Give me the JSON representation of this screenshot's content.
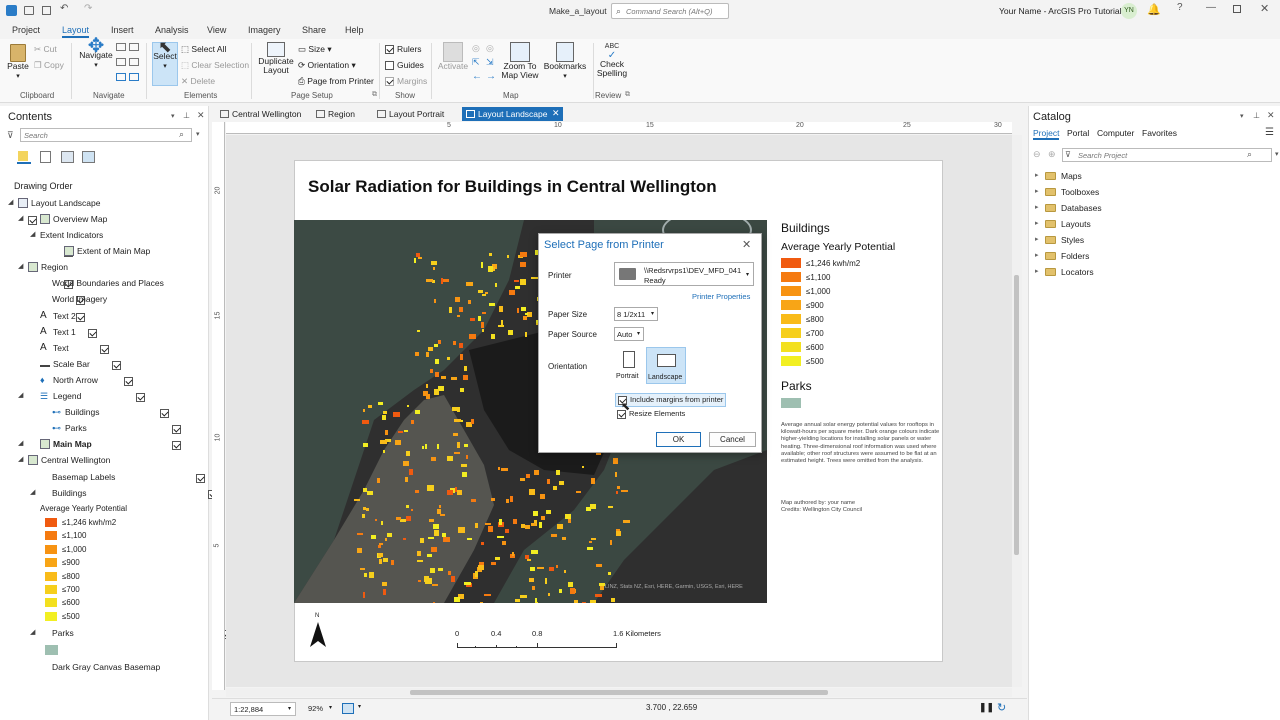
{
  "app": {
    "project_name": "Make_a_layout",
    "search_placeholder": "Command Search (Alt+Q)",
    "user": "Your Name - ArcGIS Pro Tutorials",
    "user_initials": "YN",
    "accent": "#1e6fb8"
  },
  "ribbon_tabs": [
    "Project",
    "Layout",
    "Insert",
    "Analysis",
    "View",
    "Imagery",
    "Share",
    "Help"
  ],
  "ribbon": {
    "clipboard": {
      "paste": "Paste",
      "cut": "Cut",
      "copy": "Copy",
      "label": "Clipboard"
    },
    "navigate": {
      "navigate": "Navigate",
      "label": "Navigate"
    },
    "elements": {
      "select": "Select",
      "select_all": "Select All",
      "clear_selection": "Clear Selection",
      "delete": "Delete",
      "label": "Elements"
    },
    "page_setup": {
      "duplicate": "Duplicate Layout",
      "size": "Size",
      "orientation": "Orientation",
      "page_from_printer": "Page from Printer",
      "label": "Page Setup"
    },
    "show": {
      "rulers": "Rulers",
      "guides": "Guides",
      "margins": "Margins",
      "label": "Show"
    },
    "map": {
      "activate": "Activate",
      "zoom_to": "Zoom To Map View",
      "bookmarks": "Bookmarks",
      "label": "Map"
    },
    "review": {
      "check_spelling": "Check Spelling",
      "abc": "ABC",
      "label": "Review"
    }
  },
  "contents": {
    "title": "Contents",
    "search_placeholder": "Search",
    "drawing_order": "Drawing Order",
    "items": [
      {
        "label": "Layout Landscape"
      },
      {
        "label": "Overview Map"
      },
      {
        "label": "Extent Indicators"
      },
      {
        "label": "Extent of Main Map"
      },
      {
        "label": "Region"
      },
      {
        "label": "World Boundaries and Places"
      },
      {
        "label": "World Imagery"
      },
      {
        "label": "Text 2"
      },
      {
        "label": "Text 1"
      },
      {
        "label": "Text"
      },
      {
        "label": "Scale Bar"
      },
      {
        "label": "North Arrow"
      },
      {
        "label": "Legend"
      },
      {
        "label": "Buildings"
      },
      {
        "label": "Parks"
      },
      {
        "label": "Main Map"
      },
      {
        "label": "Central Wellington"
      },
      {
        "label": "Basemap Labels"
      },
      {
        "label": "Buildings"
      },
      {
        "label": "Average Yearly Potential"
      },
      {
        "label": "Parks"
      },
      {
        "label": "Dark Gray Canvas Basemap"
      }
    ],
    "legend_classes": [
      "≤1,246 kwh/m2",
      "≤1,100",
      "≤1,000",
      "≤900",
      "≤800",
      "≤700",
      "≤600",
      "≤500"
    ],
    "legend_colors": [
      "#f05a10",
      "#f57a10",
      "#f79312",
      "#f8a516",
      "#f9bb19",
      "#f6cf1c",
      "#f3e01f",
      "#f2ef22"
    ],
    "park_color": "#9ebfb1"
  },
  "view_tabs": [
    "Central Wellington",
    "Region",
    "Layout Portrait",
    "Layout Landscape"
  ],
  "ruler_h": [
    "5",
    "10",
    "15",
    "20",
    "25",
    "30"
  ],
  "ruler_v": [
    "20",
    "15",
    "10",
    "5"
  ],
  "layout": {
    "title": "Solar Radiation for Buildings in Central Wellington",
    "legend_title": "Buildings",
    "legend_subtitle": "Average Yearly Potential",
    "parks_title": "Parks",
    "description": "Average annual solar energy potential values for rooftops in kilowatt-hours per square meter. Dark orange colours indicate higher-yielding locations for installing solar panels or water heating. Three-dimensional roof information was used where available; other roof structures were assumed to be flat at an estimated height. Trees were omitted from the analysis.",
    "author": "Map authored by: your name",
    "credits": "Credits: Wellington City Council",
    "attribution": "LINZ, Stats NZ, Esri, HERE, Garmin, USGS, Esri, HERE",
    "north": "N",
    "scale_labels": [
      "0",
      "0.4",
      "0.8",
      "1.6 Kilometers"
    ]
  },
  "dialog": {
    "title": "Select Page from Printer",
    "printer_label": "Printer",
    "printer_name": "\\\\Redsrvrps1\\DEV_MFD_041",
    "printer_status": "Ready",
    "printer_properties": "Printer Properties",
    "paper_size_label": "Paper Size",
    "paper_size": "8 1/2x11",
    "paper_source_label": "Paper Source",
    "paper_source": "Auto",
    "orientation_label": "Orientation",
    "portrait": "Portrait",
    "landscape": "Landscape",
    "include_margins": "Include margins from printer",
    "resize_elements": "Resize Elements",
    "ok": "OK",
    "cancel": "Cancel"
  },
  "catalog": {
    "title": "Catalog",
    "tabs": [
      "Project",
      "Portal",
      "Computer",
      "Favorites"
    ],
    "search_placeholder": "Search Project",
    "items": [
      "Maps",
      "Toolboxes",
      "Databases",
      "Layouts",
      "Styles",
      "Folders",
      "Locators"
    ]
  },
  "status": {
    "scale": "1:22,884",
    "zoom": "92%",
    "coords": "3.700 , 22.659"
  }
}
